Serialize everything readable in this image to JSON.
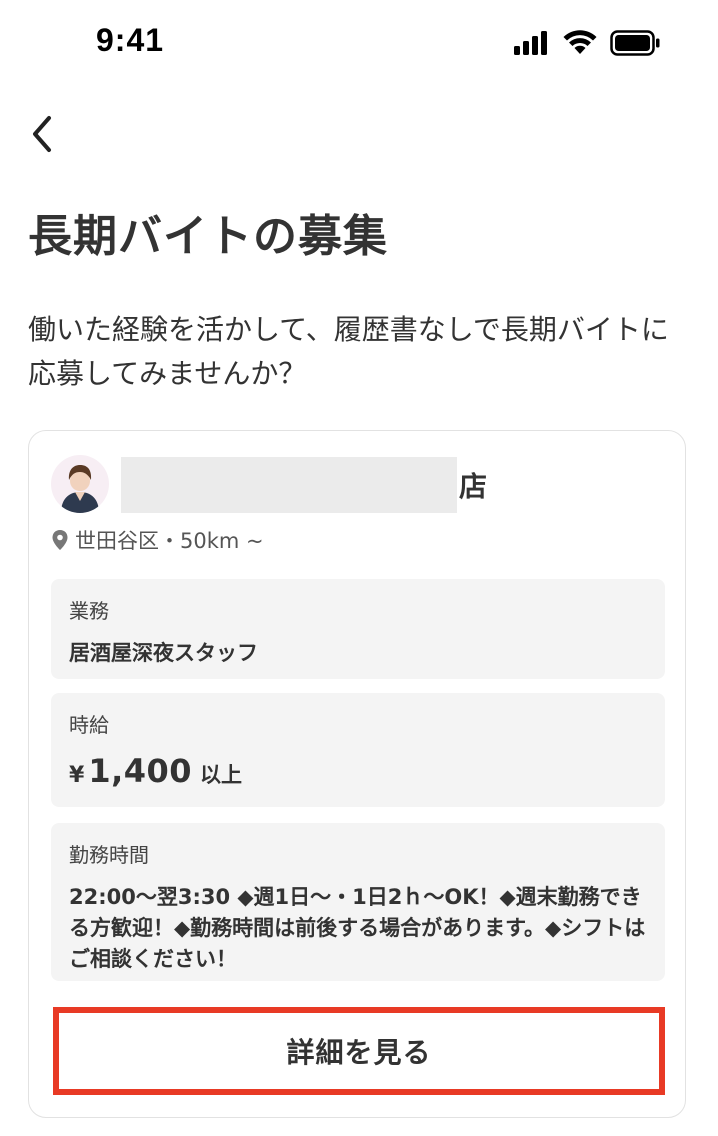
{
  "status_bar": {
    "time": "9:41",
    "icons": [
      "cellular-signal-icon",
      "wifi-icon",
      "battery-icon"
    ]
  },
  "header": {
    "back_icon": "chevron-left-icon",
    "title": "長期バイトの募集",
    "description": "働いた経験を活かして、履歴書なしで長期バイトに応募してみませんか？"
  },
  "job_card": {
    "store_suffix": "店",
    "location": "世田谷区・50km ~",
    "task": {
      "label": "業務",
      "value": "居酒屋深夜スタッフ"
    },
    "wage": {
      "label": "時給",
      "currency": "¥",
      "amount": "1,400",
      "suffix": "以上"
    },
    "hours": {
      "label": "勤務時間",
      "value": "22:00〜翌3:30 ◆週1日〜・1日2ｈ〜OK！◆週末勤務できる方歓迎！◆勤務時間は前後する場合があります。◆シフトはご相談ください！"
    },
    "detail_button_label": "詳細を見る"
  },
  "colors": {
    "text": "#333333",
    "highlight_border": "#e83a25",
    "info_box_bg": "#f4f4f4",
    "card_border": "#e2e2e2"
  }
}
